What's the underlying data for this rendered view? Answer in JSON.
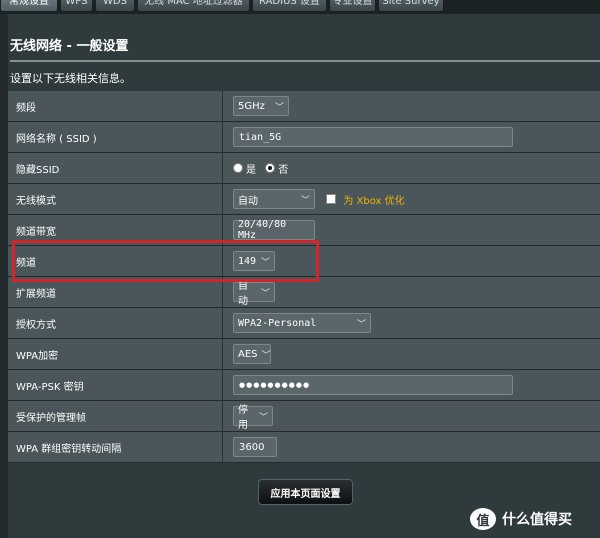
{
  "tabs": [
    "常规设置",
    "WPS",
    "WDS",
    "无线 MAC 地址过滤器",
    "RADIUS 设置",
    "专业设置",
    "Site Survey"
  ],
  "page_title": "无线网络 - 一般设置",
  "description": "设置以下无线相关信息。",
  "rows": {
    "band": {
      "label": "频段",
      "value": "5GHz"
    },
    "ssid": {
      "label": "网络名称 ( SSID )",
      "value": "tian_5G"
    },
    "hide_ssid": {
      "label": "隐藏SSID",
      "yes": "是",
      "no": "否",
      "selected": "no"
    },
    "wireless_mode": {
      "label": "无线模式",
      "value": "自动",
      "xbox_label": "为 Xbox 优化"
    },
    "bandwidth": {
      "label": "频道带宽",
      "value": "20/40/80 MHz"
    },
    "channel": {
      "label": "频道",
      "value": "149"
    },
    "ext_channel": {
      "label": "扩展频道",
      "value": "自动"
    },
    "auth_method": {
      "label": "授权方式",
      "value": "WPA2-Personal"
    },
    "wpa_encryption": {
      "label": "WPA加密",
      "value": "AES"
    },
    "wpa_psk": {
      "label": "WPA-PSK 密钥",
      "value": "●●●●●●●●●●"
    },
    "pmf": {
      "label": "受保护的管理帧",
      "value": "停用"
    },
    "group_key": {
      "label": "WPA 群组密钥转动间隔",
      "value": "3600"
    }
  },
  "apply_button": "应用本页面设置",
  "watermark": {
    "icon": "值",
    "text": "什么值得买"
  },
  "colors": {
    "background": "#2f3a3c",
    "row": "#4a5659",
    "highlight": "#d0252b",
    "xbox": "#f2b400"
  }
}
